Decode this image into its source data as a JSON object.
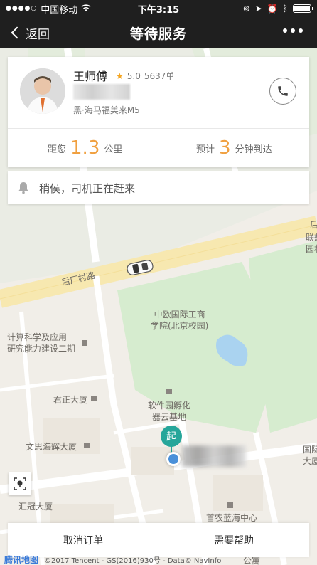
{
  "status_bar": {
    "carrier": "中国移动",
    "time": "下午3:15"
  },
  "nav": {
    "back_label": "返回",
    "title": "等待服务"
  },
  "driver": {
    "name": "王师傅",
    "rating": "5.0",
    "orders": "5637单",
    "car_model": "黑·海马福美来M5",
    "distance_prefix": "距您",
    "distance_value": "1.3",
    "distance_unit": "公里",
    "eta_prefix": "预计",
    "eta_value": "3",
    "eta_unit": "分钟到达"
  },
  "notice": {
    "text": "稍侯，司机正在赶来"
  },
  "map": {
    "road_label": "后厂村路",
    "labels": {
      "school": "中欧国际工商\n学院(北京校园)",
      "institute": "计算科学及应用\n研究能力建设二期",
      "junzheng": "君正大厦",
      "softpark": "软件园孵化\n器云基地",
      "sihai": "文思海辉大厦",
      "huiguan": "汇冠大厦",
      "shounong": "首农蓝海中心",
      "guoji": "国际\n大厦",
      "lianxiang": "联想\n园林",
      "hou": "后",
      "gongyu": "公寓"
    },
    "start_marker": "起",
    "copyright": "©2017 Tencent - GS(2016)930号 - Data© NavInfo",
    "logo": "腾讯地图"
  },
  "actions": {
    "cancel": "取消订单",
    "help": "需要帮助"
  }
}
